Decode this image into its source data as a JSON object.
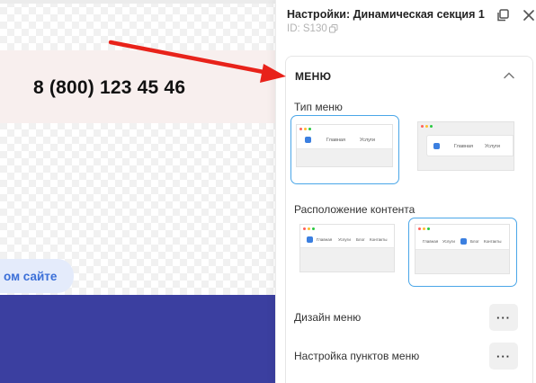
{
  "canvas": {
    "phone": "8 (800) 123 45 46",
    "site_button": "ом сайте"
  },
  "panel": {
    "title": "Настройки: Динамическая секция 1",
    "id_label": "ID: S130",
    "icons": [
      "detach-icon",
      "close-icon",
      "copy-icon",
      "chevron-up-icon",
      "arrow-annotation"
    ],
    "section": {
      "title": "МЕНЮ",
      "menu_type_label": "Тип меню",
      "menu_type_options": [
        {
          "links": [
            "Главная",
            "Услуги"
          ],
          "selected": true
        },
        {
          "links": [
            "Главная",
            "Услуги"
          ],
          "selected": false
        }
      ],
      "content_layout_label": "Расположение контента",
      "content_layout_options": [
        {
          "links": [
            "Главная",
            "Услуги",
            "Блог",
            "Контакты"
          ],
          "selected": false
        },
        {
          "links": [
            "Главная",
            "Услуги",
            "Блог",
            "Контакты"
          ],
          "selected": true
        }
      ],
      "rows": [
        {
          "label": "Дизайн меню",
          "button": "···"
        },
        {
          "label": "Настройка пунктов меню",
          "button": "···"
        }
      ]
    }
  },
  "colors": {
    "accent": "#4aa6e8",
    "arrow": "#e8221a",
    "phone_band": "#f8efee",
    "blue_band": "#3b3fa0",
    "site_button_text": "#3b6fd8"
  }
}
